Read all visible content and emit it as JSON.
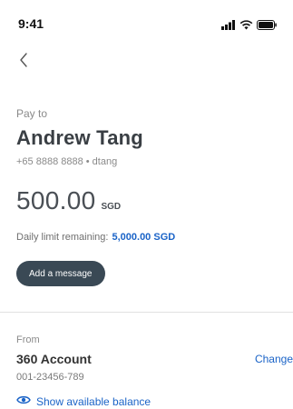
{
  "status_bar": {
    "time": "9:41",
    "icons": [
      "signal-icon",
      "wifi-icon",
      "battery-icon"
    ]
  },
  "nav": {
    "back_icon": "chevron-left-icon"
  },
  "payee": {
    "label": "Pay to",
    "name": "Andrew Tang",
    "meta": "+65 8888 8888 • dtang"
  },
  "amount": {
    "value": "500.00",
    "currency": "SGD"
  },
  "limit": {
    "label": "Daily limit remaining:",
    "value": "5,000.00 SGD"
  },
  "message_button": {
    "label": "Add a message"
  },
  "from": {
    "label": "From",
    "account_name": "360 Account",
    "account_number": "001-23456-789",
    "change_label": "Change",
    "balance_toggle_label": "Show available balance",
    "balance_icon": "eye-icon"
  },
  "colors": {
    "accent": "#1a63c7",
    "button_bg": "#3a4955",
    "divider": "#e2e2e2"
  }
}
